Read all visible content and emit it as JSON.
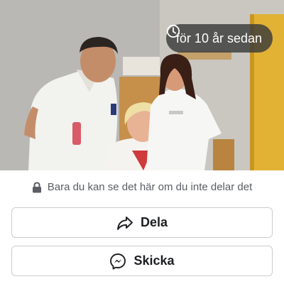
{
  "photo": {
    "alt_icon": "photo",
    "time_badge": {
      "icon": "clock-icon",
      "label": "för 10 år sedan"
    }
  },
  "privacy": {
    "icon": "lock-icon",
    "text": "Bara du kan se det här om du inte delar det"
  },
  "actions": {
    "share": {
      "icon": "share-arrow-icon",
      "label": "Dela"
    },
    "send": {
      "icon": "messenger-icon",
      "label": "Skicka"
    }
  },
  "colors": {
    "badge_bg": "#3a3a3a",
    "text_dark": "#1c1e21",
    "text_muted": "#5a5d63",
    "border": "#c9ccd1"
  }
}
